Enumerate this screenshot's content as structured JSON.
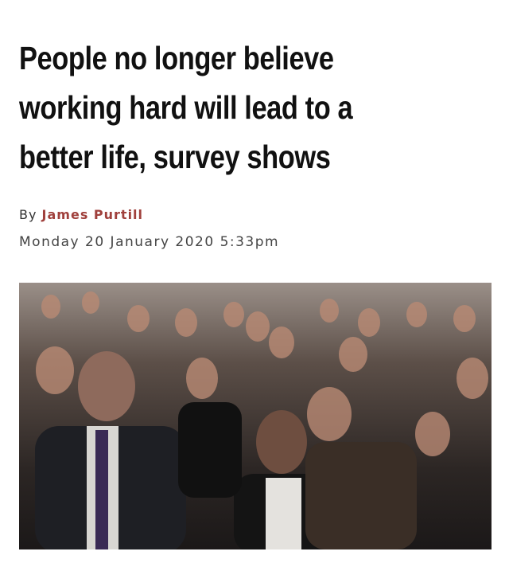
{
  "article": {
    "headline_lines": [
      "People no longer believe",
      "working hard will lead to a",
      "better life, survey shows"
    ],
    "byline_prefix": "By",
    "author": "James Purtill",
    "date": "Monday 20 January 2020 5:33pm",
    "photo_icon": "crowd-photo"
  },
  "colors": {
    "author": "#a0403c",
    "headline": "#111111"
  }
}
